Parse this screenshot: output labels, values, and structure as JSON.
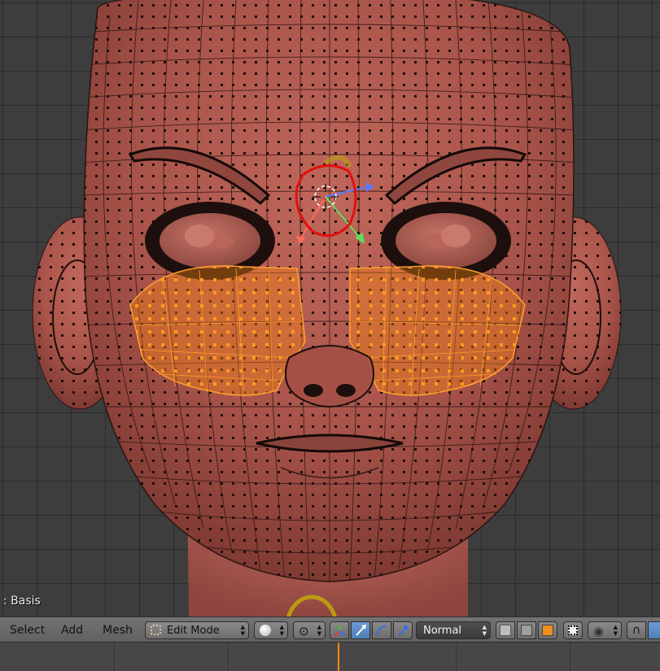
{
  "viewport": {
    "shape_key_label": ": Basis"
  },
  "header": {
    "menus": [
      "Select",
      "Add",
      "Mesh"
    ],
    "mode": {
      "label": "Edit Mode"
    },
    "transform_orientation": {
      "label": "Normal"
    }
  },
  "icons": {
    "mode_icon": "object-data-icon",
    "shading": "solid-sphere-icon",
    "pivot": "pivot-point-icon",
    "manipulator": "manipulator-axes-icon",
    "translate": "translate-arrow-icon",
    "rotate": "rotate-arc-icon",
    "scale": "scale-icon",
    "vertex_select": "vertex-select-icon",
    "edge_select": "edge-select-icon",
    "face_select": "face-select-icon",
    "occlude": "occlude-geometry-icon",
    "proportional": "proportional-edit-icon",
    "snap": "snap-magnet-icon"
  },
  "colors": {
    "skin": "#b2564a",
    "selection": "#ff8a10",
    "active_button": "#5680c2",
    "current_frame": "#ff8a10"
  }
}
